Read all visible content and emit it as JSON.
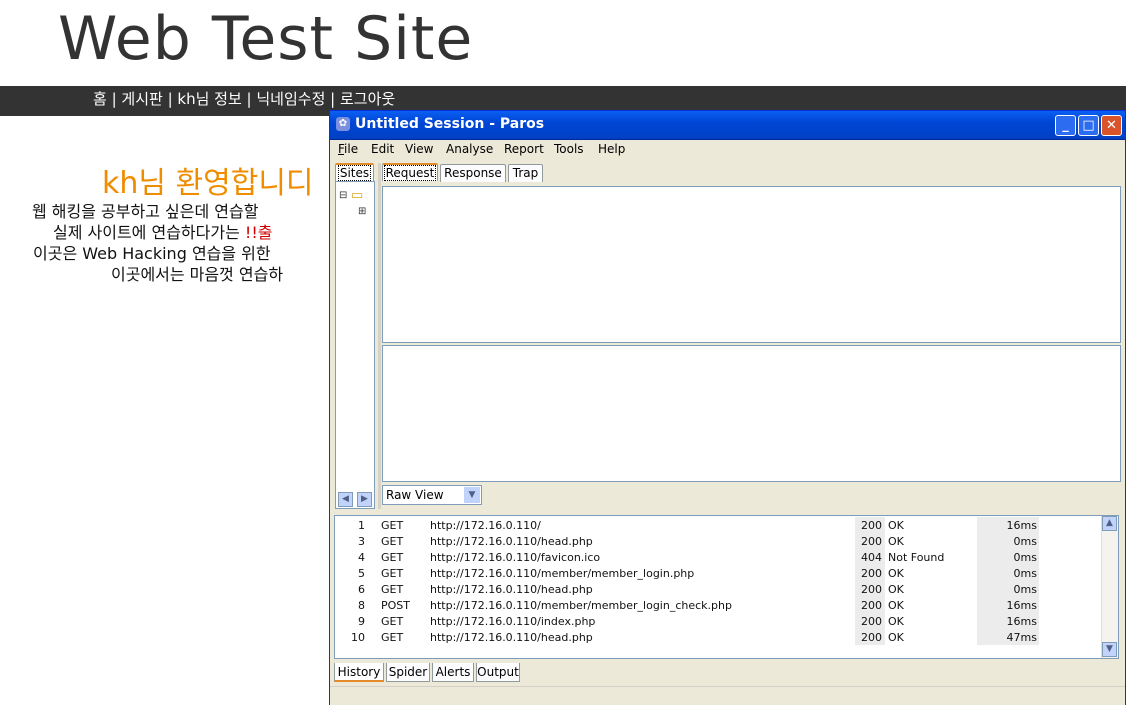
{
  "site": {
    "title": "Web Test Site",
    "nav": [
      "홈",
      "게시판",
      "kh님 정보",
      "닉네임수정",
      "로그아웃"
    ],
    "nav_sep": " | ",
    "welcome": "kh님 환영합니디",
    "lines": [
      "웹 해킹을 공부하고 싶은데 연습할",
      "실제 사이트에 연습하다가는 ",
      "이곳은 Web Hacking 연습을 위한",
      "이곳에서는 마음껏 연습하"
    ],
    "warning_fragment": "!!출"
  },
  "window": {
    "title": "Untitled Session - Paros",
    "app_icon": "paros-icon",
    "buttons": {
      "minimize": "_",
      "maximize": "□",
      "close": "✕"
    },
    "menu": [
      {
        "label": "File",
        "mnemonic": "F",
        "rest": "ile"
      },
      {
        "label": "Edit"
      },
      {
        "label": "View"
      },
      {
        "label": "Analyse"
      },
      {
        "label": "Report"
      },
      {
        "label": "Tools"
      },
      {
        "label": "Help"
      }
    ]
  },
  "sites_panel": {
    "tab": "Sites"
  },
  "request_panel": {
    "tabs": [
      "Request",
      "Response",
      "Trap"
    ],
    "active_tab": "Request",
    "view_select": "Raw View"
  },
  "history": {
    "rows": [
      {
        "id": "1",
        "method": "GET",
        "url": "http://172.16.0.110/",
        "status": "200",
        "reason": "OK",
        "time": "16ms"
      },
      {
        "id": "3",
        "method": "GET",
        "url": "http://172.16.0.110/head.php",
        "status": "200",
        "reason": "OK",
        "time": "0ms"
      },
      {
        "id": "4",
        "method": "GET",
        "url": "http://172.16.0.110/favicon.ico",
        "status": "404",
        "reason": "Not Found",
        "time": "0ms"
      },
      {
        "id": "5",
        "method": "GET",
        "url": "http://172.16.0.110/member/member_login.php",
        "status": "200",
        "reason": "OK",
        "time": "0ms"
      },
      {
        "id": "6",
        "method": "GET",
        "url": "http://172.16.0.110/head.php",
        "status": "200",
        "reason": "OK",
        "time": "0ms"
      },
      {
        "id": "8",
        "method": "POST",
        "url": "http://172.16.0.110/member/member_login_check.php",
        "status": "200",
        "reason": "OK",
        "time": "16ms"
      },
      {
        "id": "9",
        "method": "GET",
        "url": "http://172.16.0.110/index.php",
        "status": "200",
        "reason": "OK",
        "time": "16ms"
      },
      {
        "id": "10",
        "method": "GET",
        "url": "http://172.16.0.110/head.php",
        "status": "200",
        "reason": "OK",
        "time": "47ms"
      }
    ]
  },
  "bottom_tabs": [
    "History",
    "Spider",
    "Alerts",
    "Output"
  ],
  "active_bottom_tab": "History",
  "colors": {
    "accent": "#f08c00",
    "navbar": "#333333",
    "titlebar": "#0046d5",
    "tab_highlight": "#e68b2c"
  }
}
